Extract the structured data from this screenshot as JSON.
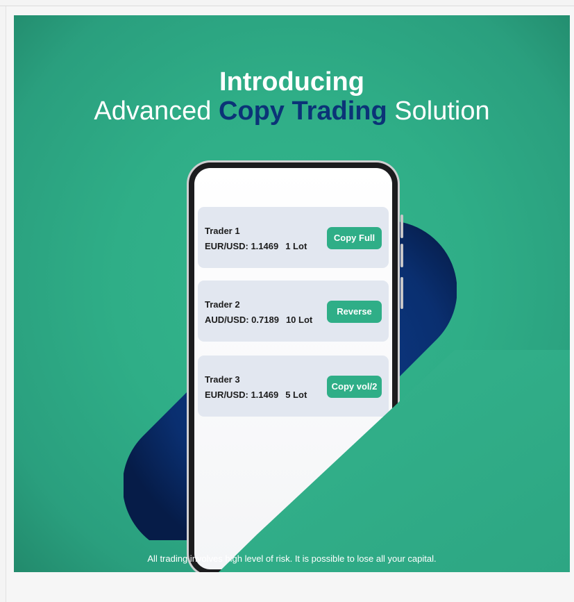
{
  "banner": {
    "title_line1": "Introducing",
    "title_line2_pre": "Advanced ",
    "title_line2_accent": "Copy Trading",
    "title_line2_post": " Solution",
    "disclaimer": "All trading involves high level of risk. It is possible to lose all your capital."
  },
  "colors": {
    "background_green": "#2fae87",
    "accent_navy": "#0b3377",
    "card_bg": "#e2e7f0",
    "button_green": "#2fae87"
  },
  "traders": [
    {
      "name": "Trader 1",
      "pair": "EUR/USD: 1.1469",
      "lot": "1 Lot",
      "action": "Copy Full"
    },
    {
      "name": "Trader 2",
      "pair": "AUD/USD: 0.7189",
      "lot": "10 Lot",
      "action": "Reverse"
    },
    {
      "name": "Trader 3",
      "pair": "EUR/USD: 1.1469",
      "lot": "5 Lot",
      "action": "Copy vol/2"
    }
  ]
}
